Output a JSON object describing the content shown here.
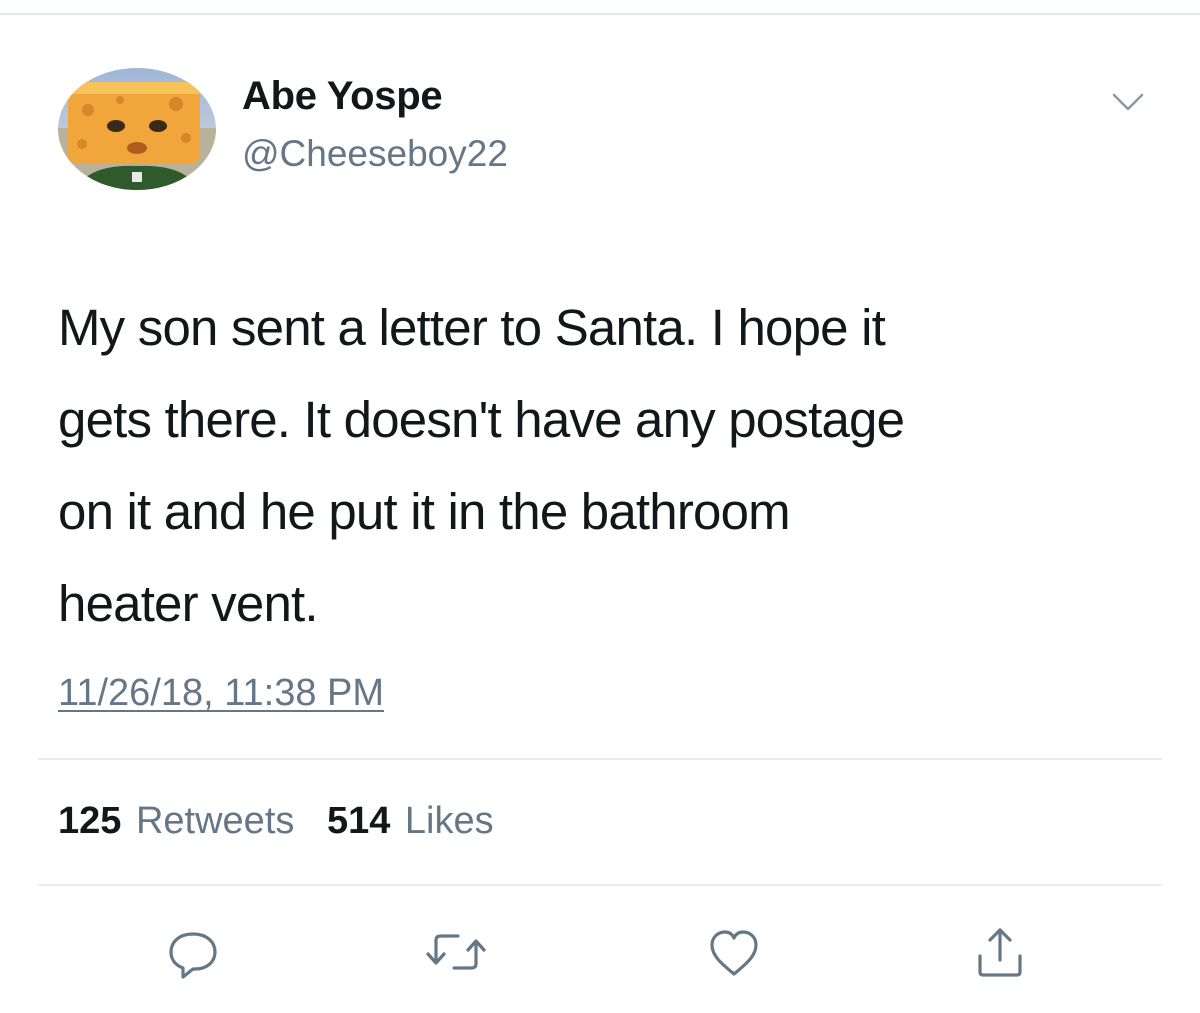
{
  "user": {
    "name": "Abe Yospe",
    "handle": "@Cheeseboy22"
  },
  "tweet": {
    "text": "My son sent a letter to Santa. I hope it\ngets there. It doesn't have any postage\non it and he put it in the bathroom\nheater vent.",
    "timestamp": "11/26/18, 11:38 PM"
  },
  "stats": {
    "retweets_count": "125",
    "retweets_label": "Retweets",
    "likes_count": "514",
    "likes_label": "Likes"
  },
  "icons": {
    "menu": "chevron-down-icon",
    "reply": "reply-icon",
    "retweet": "retweet-icon",
    "like": "heart-icon",
    "share": "share-icon"
  },
  "colors": {
    "text": "#14171a",
    "secondary": "#657786",
    "divider": "#e6ecf0"
  }
}
